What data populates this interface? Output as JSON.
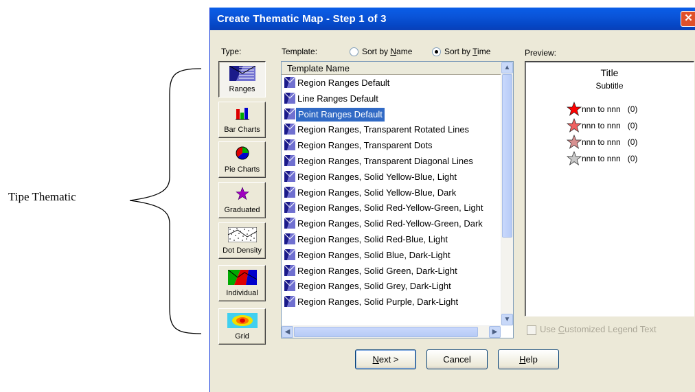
{
  "annotation": {
    "label": "Tipe Thematic"
  },
  "dialog": {
    "title": "Create Thematic Map - Step 1 of 3",
    "close_glyph": "✕"
  },
  "type_section": {
    "label": "Type:",
    "buttons": [
      {
        "label": "Ranges",
        "icon": "ranges-icon",
        "selected": true
      },
      {
        "label": "Bar Charts",
        "icon": "bar-charts-icon",
        "selected": false
      },
      {
        "label": "Pie Charts",
        "icon": "pie-charts-icon",
        "selected": false
      },
      {
        "label": "Graduated",
        "icon": "graduated-icon",
        "selected": false
      },
      {
        "label": "Dot Density",
        "icon": "dot-density-icon",
        "selected": false
      },
      {
        "label": "Individual",
        "icon": "individual-icon",
        "selected": false
      },
      {
        "label": "Grid",
        "icon": "grid-icon",
        "selected": false
      }
    ]
  },
  "template_section": {
    "label": "Template:",
    "sort_by_name": {
      "prefix": "Sort by ",
      "key": "N",
      "rest": "ame",
      "checked": false
    },
    "sort_by_time": {
      "prefix": "Sort by ",
      "key": "T",
      "rest": "ime",
      "checked": true
    },
    "column_header": "Template Name",
    "items": [
      {
        "name": "Region Ranges Default",
        "selected": false
      },
      {
        "name": "Line Ranges Default",
        "selected": false
      },
      {
        "name": "Point Ranges Default",
        "selected": true
      },
      {
        "name": "Region Ranges, Transparent Rotated Lines",
        "selected": false
      },
      {
        "name": "Region Ranges, Transparent Dots",
        "selected": false
      },
      {
        "name": "Region Ranges, Transparent Diagonal Lines",
        "selected": false
      },
      {
        "name": "Region Ranges, Solid Yellow-Blue, Light",
        "selected": false
      },
      {
        "name": "Region Ranges, Solid Yellow-Blue, Dark",
        "selected": false
      },
      {
        "name": "Region Ranges, Solid Red-Yellow-Green, Light",
        "selected": false
      },
      {
        "name": "Region Ranges, Solid Red-Yellow-Green, Dark",
        "selected": false
      },
      {
        "name": "Region Ranges, Solid Red-Blue, Light",
        "selected": false
      },
      {
        "name": "Region Ranges, Solid Blue, Dark-Light",
        "selected": false
      },
      {
        "name": "Region Ranges, Solid Green, Dark-Light",
        "selected": false
      },
      {
        "name": "Region Ranges, Solid Grey, Dark-Light",
        "selected": false
      },
      {
        "name": "Region Ranges, Solid Purple, Dark-Light",
        "selected": false
      }
    ]
  },
  "preview": {
    "label": "Preview:",
    "title": "Title",
    "subtitle": "Subtitle",
    "legend": [
      {
        "text": "nnn to nnn   (0)",
        "color": "#ff0000"
      },
      {
        "text": "nnn to nnn   (0)",
        "color": "#f06060"
      },
      {
        "text": "nnn to nnn   (0)",
        "color": "#d89090"
      },
      {
        "text": "nnn to nnn   (0)",
        "color": "#c8c8c8"
      }
    ]
  },
  "customized_legend": {
    "label_prefix": "Use ",
    "key": "C",
    "label_rest": "ustomized Legend Text",
    "checked": false,
    "enabled": false
  },
  "buttons": {
    "next": {
      "key": "N",
      "rest": "ext >"
    },
    "cancel": "Cancel",
    "help": {
      "key": "H",
      "rest": "elp"
    }
  }
}
